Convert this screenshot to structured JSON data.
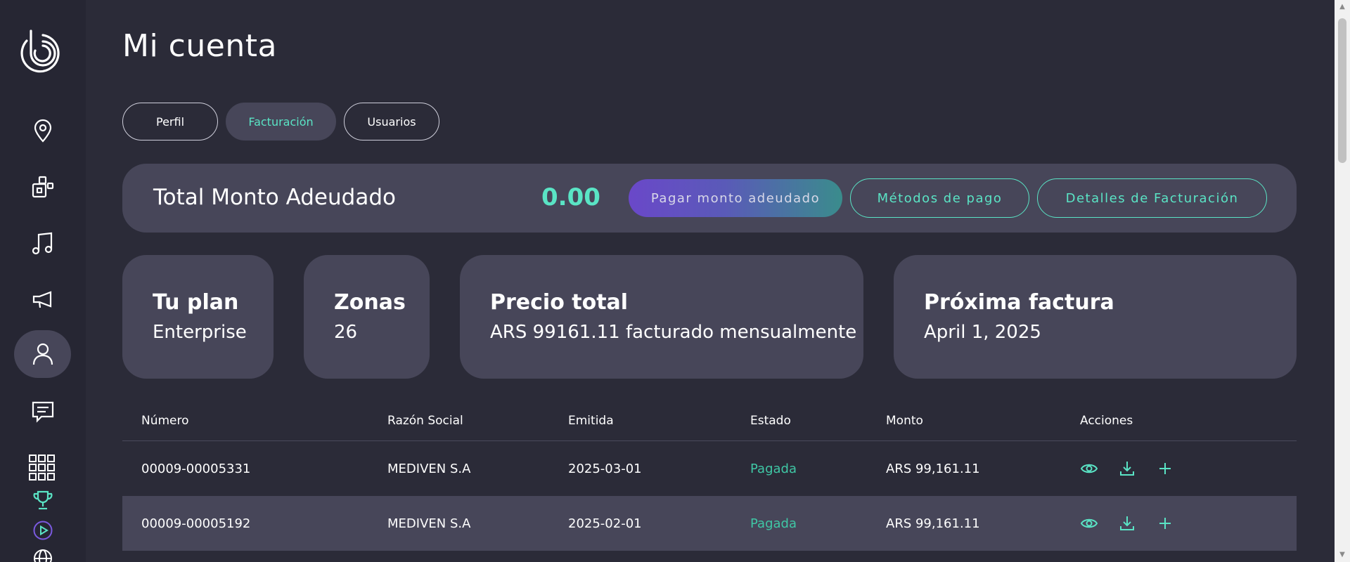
{
  "page": {
    "title": "Mi cuenta"
  },
  "tabs": [
    {
      "label": "Perfil"
    },
    {
      "label": "Facturación"
    },
    {
      "label": "Usuarios"
    }
  ],
  "sidebar": {
    "items": [
      {
        "icon": "map-pin-icon"
      },
      {
        "icon": "boxes-icon"
      },
      {
        "icon": "music-note-icon"
      },
      {
        "icon": "megaphone-icon"
      },
      {
        "icon": "user-icon",
        "active": true
      },
      {
        "icon": "message-icon"
      },
      {
        "icon": "grid-icon"
      },
      {
        "icon": "trophy-icon"
      },
      {
        "icon": "play-circle-icon"
      },
      {
        "icon": "globe-icon"
      }
    ]
  },
  "owed": {
    "label": "Total Monto Adeudado",
    "value": "0.00",
    "pay_label": "Pagar monto adeudado",
    "methods_label": "Métodos de pago",
    "details_label": "Detalles de Facturación"
  },
  "cards": {
    "plan": {
      "title": "Tu plan",
      "value": "Enterprise"
    },
    "zones": {
      "title": "Zonas",
      "value": "26"
    },
    "price": {
      "title": "Precio total",
      "value": "ARS 99161.11 facturado mensualmente"
    },
    "next": {
      "title": "Próxima factura",
      "value": "April 1, 2025"
    }
  },
  "table": {
    "headers": [
      "Número",
      "Razón Social",
      "Emitida",
      "Estado",
      "Monto",
      "Acciones"
    ],
    "rows": [
      {
        "numero": "00009-00005331",
        "razon": "MEDIVEN S.A",
        "emitida": "2025-03-01",
        "estado": "Pagada",
        "monto": "ARS 99,161.11"
      },
      {
        "numero": "00009-00005192",
        "razon": "MEDIVEN S.A",
        "emitida": "2025-02-01",
        "estado": "Pagada",
        "monto": "ARS 99,161.11"
      }
    ]
  },
  "colors": {
    "accent": "#5ae4c5",
    "card": "#474659",
    "bg": "#2b2b38",
    "sidebar": "#262633"
  }
}
